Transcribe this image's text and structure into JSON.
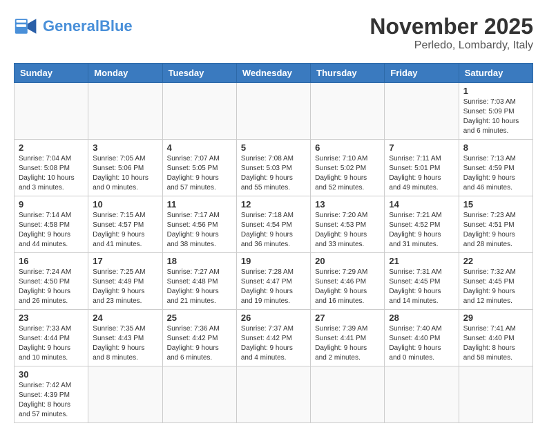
{
  "header": {
    "logo_general": "General",
    "logo_blue": "Blue",
    "month_title": "November 2025",
    "location": "Perledo, Lombardy, Italy"
  },
  "days_of_week": [
    "Sunday",
    "Monday",
    "Tuesday",
    "Wednesday",
    "Thursday",
    "Friday",
    "Saturday"
  ],
  "weeks": [
    [
      {
        "day": "",
        "info": ""
      },
      {
        "day": "",
        "info": ""
      },
      {
        "day": "",
        "info": ""
      },
      {
        "day": "",
        "info": ""
      },
      {
        "day": "",
        "info": ""
      },
      {
        "day": "",
        "info": ""
      },
      {
        "day": "1",
        "info": "Sunrise: 7:03 AM\nSunset: 5:09 PM\nDaylight: 10 hours and 6 minutes."
      }
    ],
    [
      {
        "day": "2",
        "info": "Sunrise: 7:04 AM\nSunset: 5:08 PM\nDaylight: 10 hours and 3 minutes."
      },
      {
        "day": "3",
        "info": "Sunrise: 7:05 AM\nSunset: 5:06 PM\nDaylight: 10 hours and 0 minutes."
      },
      {
        "day": "4",
        "info": "Sunrise: 7:07 AM\nSunset: 5:05 PM\nDaylight: 9 hours and 57 minutes."
      },
      {
        "day": "5",
        "info": "Sunrise: 7:08 AM\nSunset: 5:03 PM\nDaylight: 9 hours and 55 minutes."
      },
      {
        "day": "6",
        "info": "Sunrise: 7:10 AM\nSunset: 5:02 PM\nDaylight: 9 hours and 52 minutes."
      },
      {
        "day": "7",
        "info": "Sunrise: 7:11 AM\nSunset: 5:01 PM\nDaylight: 9 hours and 49 minutes."
      },
      {
        "day": "8",
        "info": "Sunrise: 7:13 AM\nSunset: 4:59 PM\nDaylight: 9 hours and 46 minutes."
      }
    ],
    [
      {
        "day": "9",
        "info": "Sunrise: 7:14 AM\nSunset: 4:58 PM\nDaylight: 9 hours and 44 minutes."
      },
      {
        "day": "10",
        "info": "Sunrise: 7:15 AM\nSunset: 4:57 PM\nDaylight: 9 hours and 41 minutes."
      },
      {
        "day": "11",
        "info": "Sunrise: 7:17 AM\nSunset: 4:56 PM\nDaylight: 9 hours and 38 minutes."
      },
      {
        "day": "12",
        "info": "Sunrise: 7:18 AM\nSunset: 4:54 PM\nDaylight: 9 hours and 36 minutes."
      },
      {
        "day": "13",
        "info": "Sunrise: 7:20 AM\nSunset: 4:53 PM\nDaylight: 9 hours and 33 minutes."
      },
      {
        "day": "14",
        "info": "Sunrise: 7:21 AM\nSunset: 4:52 PM\nDaylight: 9 hours and 31 minutes."
      },
      {
        "day": "15",
        "info": "Sunrise: 7:23 AM\nSunset: 4:51 PM\nDaylight: 9 hours and 28 minutes."
      }
    ],
    [
      {
        "day": "16",
        "info": "Sunrise: 7:24 AM\nSunset: 4:50 PM\nDaylight: 9 hours and 26 minutes."
      },
      {
        "day": "17",
        "info": "Sunrise: 7:25 AM\nSunset: 4:49 PM\nDaylight: 9 hours and 23 minutes."
      },
      {
        "day": "18",
        "info": "Sunrise: 7:27 AM\nSunset: 4:48 PM\nDaylight: 9 hours and 21 minutes."
      },
      {
        "day": "19",
        "info": "Sunrise: 7:28 AM\nSunset: 4:47 PM\nDaylight: 9 hours and 19 minutes."
      },
      {
        "day": "20",
        "info": "Sunrise: 7:29 AM\nSunset: 4:46 PM\nDaylight: 9 hours and 16 minutes."
      },
      {
        "day": "21",
        "info": "Sunrise: 7:31 AM\nSunset: 4:45 PM\nDaylight: 9 hours and 14 minutes."
      },
      {
        "day": "22",
        "info": "Sunrise: 7:32 AM\nSunset: 4:45 PM\nDaylight: 9 hours and 12 minutes."
      }
    ],
    [
      {
        "day": "23",
        "info": "Sunrise: 7:33 AM\nSunset: 4:44 PM\nDaylight: 9 hours and 10 minutes."
      },
      {
        "day": "24",
        "info": "Sunrise: 7:35 AM\nSunset: 4:43 PM\nDaylight: 9 hours and 8 minutes."
      },
      {
        "day": "25",
        "info": "Sunrise: 7:36 AM\nSunset: 4:42 PM\nDaylight: 9 hours and 6 minutes."
      },
      {
        "day": "26",
        "info": "Sunrise: 7:37 AM\nSunset: 4:42 PM\nDaylight: 9 hours and 4 minutes."
      },
      {
        "day": "27",
        "info": "Sunrise: 7:39 AM\nSunset: 4:41 PM\nDaylight: 9 hours and 2 minutes."
      },
      {
        "day": "28",
        "info": "Sunrise: 7:40 AM\nSunset: 4:40 PM\nDaylight: 9 hours and 0 minutes."
      },
      {
        "day": "29",
        "info": "Sunrise: 7:41 AM\nSunset: 4:40 PM\nDaylight: 8 hours and 58 minutes."
      }
    ],
    [
      {
        "day": "30",
        "info": "Sunrise: 7:42 AM\nSunset: 4:39 PM\nDaylight: 8 hours and 57 minutes."
      },
      {
        "day": "",
        "info": ""
      },
      {
        "day": "",
        "info": ""
      },
      {
        "day": "",
        "info": ""
      },
      {
        "day": "",
        "info": ""
      },
      {
        "day": "",
        "info": ""
      },
      {
        "day": "",
        "info": ""
      }
    ]
  ]
}
